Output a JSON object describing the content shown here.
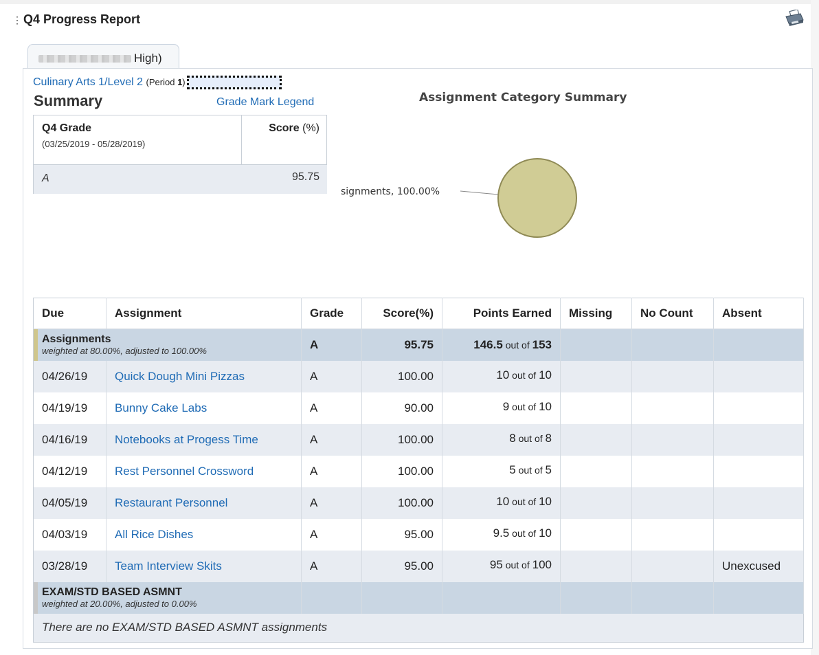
{
  "header": {
    "expand_glyph": "⋮",
    "title": "Q4 Progress Report"
  },
  "tab": {
    "label_suffix": "High)"
  },
  "course": {
    "name": "Culinary Arts 1/Level 2",
    "period_prefix": "(Period ",
    "period_num": "1",
    "period_suffix": ")"
  },
  "summary": {
    "title": "Summary",
    "legend_link": "Grade Mark Legend",
    "header_left": "Q4 Grade",
    "dates": "(03/25/2019 - 05/28/2019)",
    "header_right_bold": "Score",
    "header_right_unit": " (%)",
    "grade": "A",
    "score": "95.75"
  },
  "chart_data": {
    "type": "pie",
    "title": "Assignment Category Summary",
    "slices": [
      {
        "label": "signments",
        "value": 100.0,
        "display": "signments, 100.00%",
        "color": "#d0cc95"
      }
    ]
  },
  "table": {
    "columns": [
      "Due",
      "Assignment",
      "Grade",
      "Score(%)",
      "Points Earned",
      "Missing",
      "No Count",
      "Absent"
    ],
    "categories": [
      {
        "name": "Assignments",
        "weight_text": "weighted at 80.00%, adjusted to 100.00%",
        "grade": "A",
        "score": "95.75",
        "pts_earned": "146.5",
        "pts_mid": " out of ",
        "pts_total": "153",
        "bar_color": "#cfc68c"
      },
      {
        "name": "EXAM/STD BASED ASMNT",
        "weight_text": "weighted at 20.00%, adjusted to 0.00%",
        "bar_color": "#c8c8c8",
        "empty_message": "There are no EXAM/STD BASED ASMNT assignments"
      }
    ],
    "rows": [
      {
        "due": "04/26/19",
        "assignment": "Quick Dough Mini Pizzas",
        "grade": "A",
        "score": "100.00",
        "earned": "10",
        "mid": " out of ",
        "total": "10",
        "missing": "",
        "nocount": "",
        "absent": ""
      },
      {
        "due": "04/19/19",
        "assignment": "Bunny Cake Labs",
        "grade": "A",
        "score": "90.00",
        "earned": "9",
        "mid": " out of ",
        "total": "10",
        "missing": "",
        "nocount": "",
        "absent": ""
      },
      {
        "due": "04/16/19",
        "assignment": "Notebooks at Progess Time",
        "grade": "A",
        "score": "100.00",
        "earned": "8",
        "mid": " out of ",
        "total": "8",
        "missing": "",
        "nocount": "",
        "absent": ""
      },
      {
        "due": "04/12/19",
        "assignment": "Rest Personnel Crossword",
        "grade": "A",
        "score": "100.00",
        "earned": "5",
        "mid": " out of ",
        "total": "5",
        "missing": "",
        "nocount": "",
        "absent": ""
      },
      {
        "due": "04/05/19",
        "assignment": "Restaurant Personnel",
        "grade": "A",
        "score": "100.00",
        "earned": "10",
        "mid": " out of ",
        "total": "10",
        "missing": "",
        "nocount": "",
        "absent": ""
      },
      {
        "due": "04/03/19",
        "assignment": "All Rice Dishes",
        "grade": "A",
        "score": "95.00",
        "earned": "9.5",
        "mid": " out of ",
        "total": "10",
        "missing": "",
        "nocount": "",
        "absent": ""
      },
      {
        "due": "03/28/19",
        "assignment": "Team Interview Skits",
        "grade": "A",
        "score": "95.00",
        "earned": "95",
        "mid": " out of ",
        "total": "100",
        "missing": "",
        "nocount": "",
        "absent": "Unexcused"
      }
    ]
  }
}
